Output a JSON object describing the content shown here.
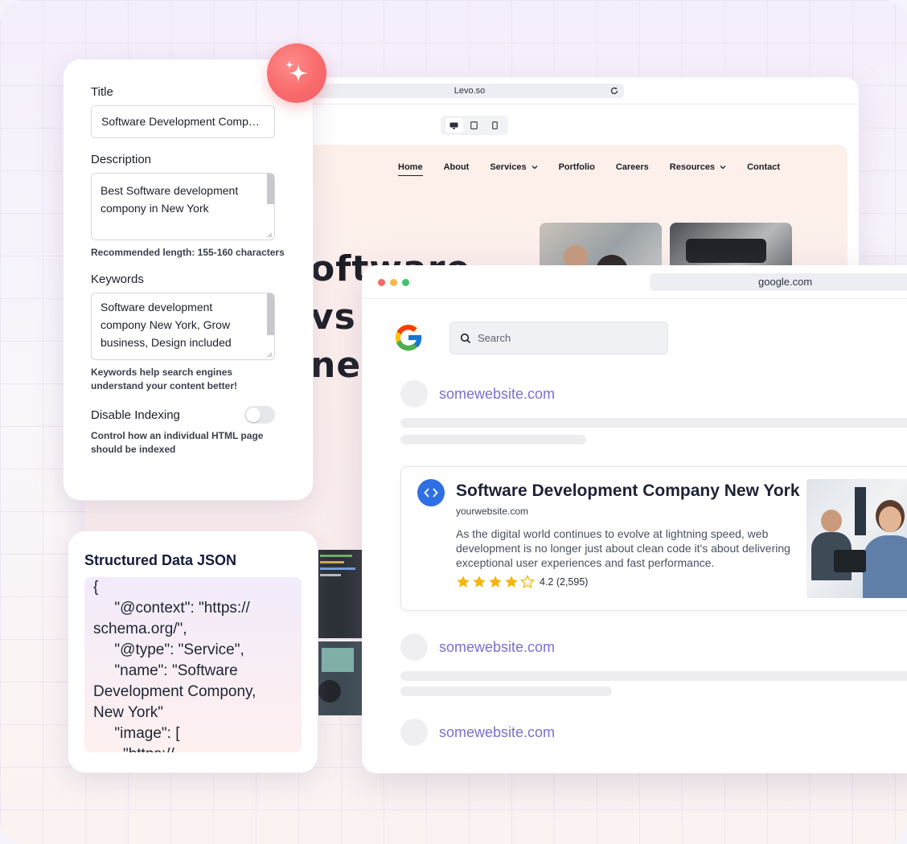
{
  "levo": {
    "url": "Levo.so",
    "nav": [
      {
        "label": "Home",
        "dropdown": false
      },
      {
        "label": "About",
        "dropdown": false
      },
      {
        "label": "Services",
        "dropdown": true
      },
      {
        "label": "Portfolio",
        "dropdown": false
      },
      {
        "label": "Careers",
        "dropdown": false
      },
      {
        "label": "Resources",
        "dropdown": true
      },
      {
        "label": "Contact",
        "dropdown": false
      }
    ],
    "hero_lines": [
      "oftware",
      "vs V",
      "nes"
    ]
  },
  "meta_panel": {
    "title_label": "Title",
    "title_value": "Software Development Company New York",
    "description_label": "Description",
    "description_value": "Best Software development compony in New York",
    "description_hint": "Recommended length: 155-160 characters",
    "keywords_label": "Keywords",
    "keywords_value": "Software development compony New York, Grow business, Design included",
    "keywords_hint": "Keywords help search engines understand your content better!",
    "indexing_label": "Disable Indexing",
    "indexing_enabled": false,
    "indexing_hint": "Control how an individual HTML page should be indexed"
  },
  "json_card": {
    "title": "Structured Data JSON",
    "code": "{\n     \"@context\": \"https://\nschema.org/\",\n     \"@type\": \"Service\",\n     \"name\": \"Software\nDevelopment Compony,\nNew York\"\n     \"image\": [\n       \"https://"
  },
  "google": {
    "url": "google.com",
    "search_placeholder": "Search",
    "stub_link": "somewebsite.com",
    "featured": {
      "title": "Software Development Company New York",
      "url": "yourwebsite.com",
      "description": "As the digital world continues to evolve at lightning speed, web development is no longer just about clean code it's about delivering exceptional user experiences and fast performance.",
      "rating": 4.2,
      "rating_text": "4.2 (2,595)",
      "stars_filled": 4,
      "stars_total": 5
    }
  },
  "colors": {
    "accent_link": "#7b6fcf",
    "featured_icon": "#2f6fe4",
    "star": "#f5b50a",
    "sparkle_button": "#f86b6b"
  }
}
